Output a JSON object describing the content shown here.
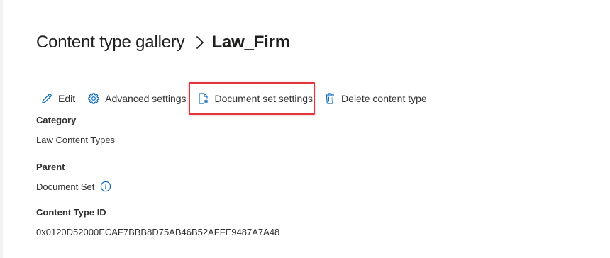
{
  "breadcrumb": {
    "root": "Content type gallery",
    "separator_icon": "chevron-right-icon",
    "current": "Law_Firm"
  },
  "commands": {
    "edit": {
      "label": "Edit",
      "icon": "pencil-icon"
    },
    "advanced_settings": {
      "label": "Advanced settings",
      "icon": "gear-icon"
    },
    "document_set_settings": {
      "label": "Document set settings",
      "icon": "document-settings-icon"
    },
    "delete_content_type": {
      "label": "Delete content type",
      "icon": "trash-icon"
    }
  },
  "details": {
    "category": {
      "label": "Category",
      "value": "Law Content Types"
    },
    "parent": {
      "label": "Parent",
      "value": "Document Set",
      "icon": "info-icon"
    },
    "content_type_id": {
      "label": "Content Type ID",
      "value": "0x0120D52000ECAF7BBB8D75AB46B52AFFE9487A7A48"
    }
  },
  "colors": {
    "accent": "#0f6cbd",
    "highlight": "#e0363c",
    "text": "#323130"
  }
}
